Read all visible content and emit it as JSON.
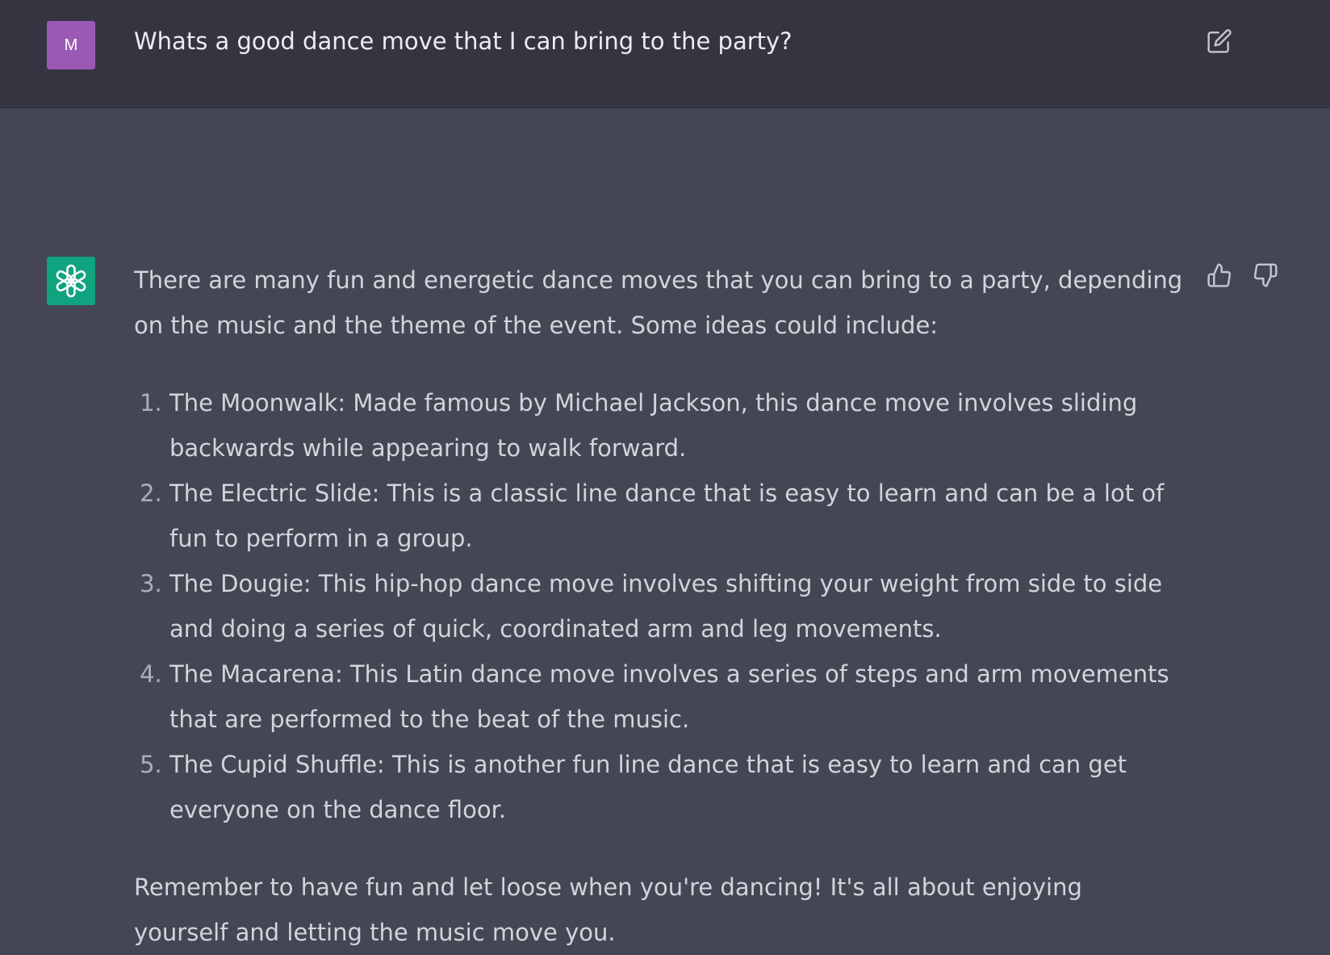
{
  "user_message": {
    "avatar_initial": "M",
    "avatar_color": "#9b59b6",
    "text": "Whats a good dance move that I can bring to the party?",
    "edit_icon": "edit-icon"
  },
  "assistant_message": {
    "avatar_icon": "openai-logo-icon",
    "avatar_color": "#10a37f",
    "intro": "There are many fun and energetic dance moves that you can bring to a party, depending on the music and the theme of the event. Some ideas could include:",
    "list": [
      "The Moonwalk: Made famous by Michael Jackson, this dance move involves sliding backwards while appearing to walk forward.",
      "The Electric Slide: This is a classic line dance that is easy to learn and can be a lot of fun to perform in a group.",
      "The Dougie: This hip-hop dance move involves shifting your weight from side to side and doing a series of quick, coordinated arm and leg movements.",
      "The Macarena: This Latin dance move involves a series of steps and arm movements that are performed to the beat of the music.",
      "The Cupid Shuffle: This is another fun line dance that is easy to learn and can get everyone on the dance floor."
    ],
    "outro": "Remember to have fun and let loose when you're dancing! It's all about enjoying yourself and letting the music move you.",
    "feedback_icons": [
      "thumbs-up-icon",
      "thumbs-down-icon"
    ]
  }
}
